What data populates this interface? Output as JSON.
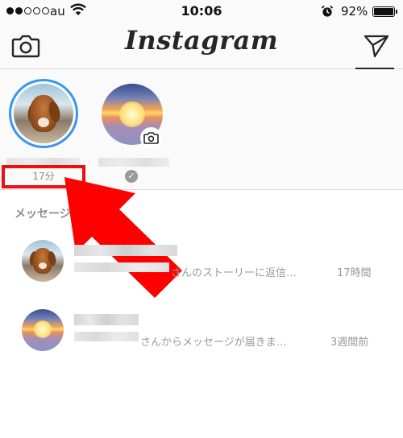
{
  "status_bar": {
    "carrier": "au",
    "time": "10:06",
    "battery_percent": "92%",
    "battery_level": 0.92,
    "signal_bars_filled": 2,
    "signal_bars_total": 5,
    "icons": [
      "signal-icon",
      "wifi-icon",
      "alarm-icon",
      "battery-icon"
    ]
  },
  "nav": {
    "logo": "Instagram",
    "left_icon": "camera-icon",
    "right_icon": "direct-send-icon"
  },
  "stories": [
    {
      "name": "",
      "time_ago": "17分",
      "ring_color": "#3897f0",
      "avatar": "dog-photo"
    },
    {
      "name": "",
      "status": "✓",
      "avatar": "sunset-photo",
      "badge_icon": "camera-icon"
    }
  ],
  "annotation": {
    "highlight_color": "#e81010",
    "arrow_color": "#ff0000"
  },
  "messages": {
    "section_title": "メッセージ",
    "threads": [
      {
        "preview": "さんのストーリーに返信…",
        "time": "17時間",
        "avatar": "dog-photo"
      },
      {
        "preview": "さんからメッセージが届きま…",
        "time": "3週間前",
        "avatar": "sunset-photo"
      }
    ]
  }
}
